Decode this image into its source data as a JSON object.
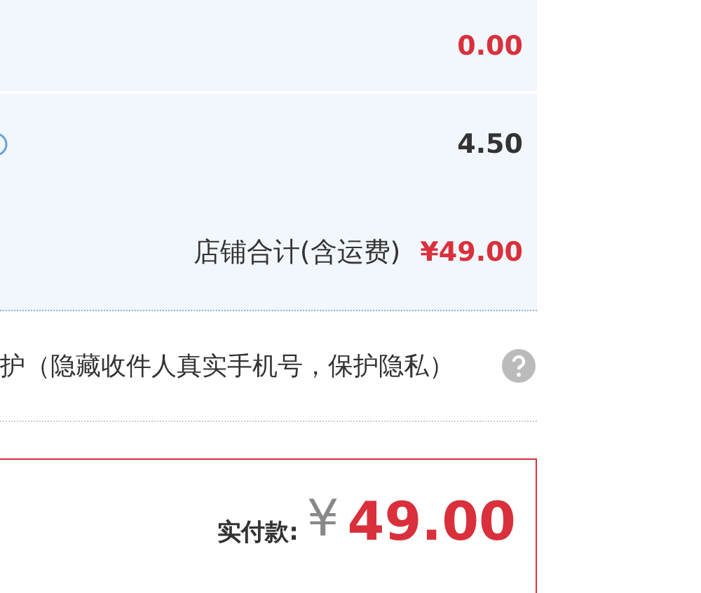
{
  "rows": [
    {
      "kind": "amount",
      "value": "0.00",
      "highlight": true
    },
    {
      "kind": "amount",
      "value": "4.50",
      "highlight": false,
      "icon": true
    },
    {
      "kind": "total",
      "label": "店铺合计(含运费)",
      "value": "¥49.00"
    }
  ],
  "privacy": {
    "text": "护（隐藏收件人真实手机号，保护隐私）"
  },
  "payment": {
    "label": "实付款:",
    "currency": "¥",
    "amount": "49.00"
  }
}
